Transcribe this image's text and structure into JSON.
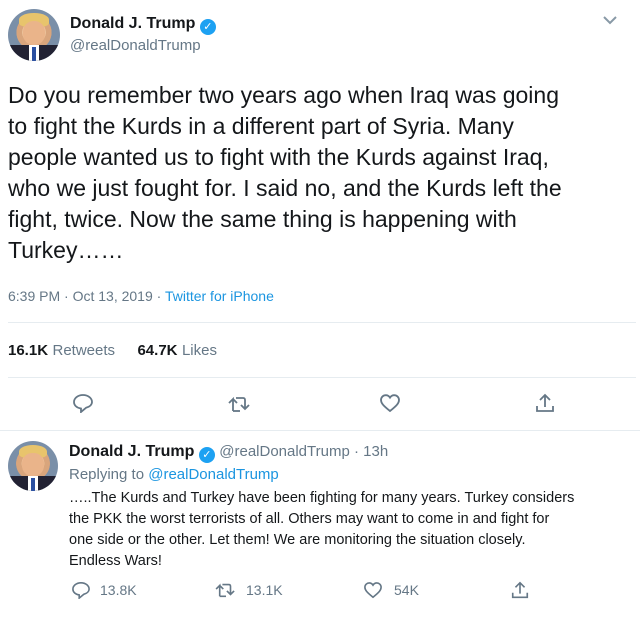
{
  "main_tweet": {
    "author_name": "Donald J. Trump",
    "author_handle": "@realDonaldTrump",
    "lines": [
      "Do you remember two years ago when Iraq was going",
      "to fight the Kurds in a different part of Syria. Many",
      "people wanted us to fight with the Kurds against Iraq,",
      "who we just fought for. I said no, and the Kurds left the",
      "fight, twice. Now the same thing is happening with",
      "Turkey……"
    ],
    "timestamp": "6:39 PM · Oct 13, 2019 ·",
    "source": "Twitter for iPhone",
    "retweets_count": "16.1K",
    "retweets_label": "Retweets",
    "likes_count": "64.7K",
    "likes_label": "Likes"
  },
  "reply_tweet": {
    "author_name": "Donald J. Trump",
    "author_handle": "@realDonaldTrump · 13h",
    "replying_prefix": "Replying to",
    "replying_handle": "@realDonaldTrump",
    "lines": [
      "…..The Kurds and Turkey have been fighting for many years. Turkey considers",
      "the PKK the worst terrorists of all. Others may want to come in and fight for",
      "one side or the other. Let them! We are monitoring the situation closely.",
      "Endless Wars!"
    ],
    "reply_count": "13.8K",
    "retweet_count": "13.1K",
    "like_count": "54K"
  },
  "colors": {
    "verified": "#1da1f2",
    "link": "#1b95e0",
    "secondary_text": "#657786",
    "divider": "#e6ecf0"
  },
  "icons": [
    "chevron-down-icon",
    "verified-badge-icon",
    "reply-icon",
    "retweet-icon",
    "like-icon",
    "share-icon"
  ]
}
